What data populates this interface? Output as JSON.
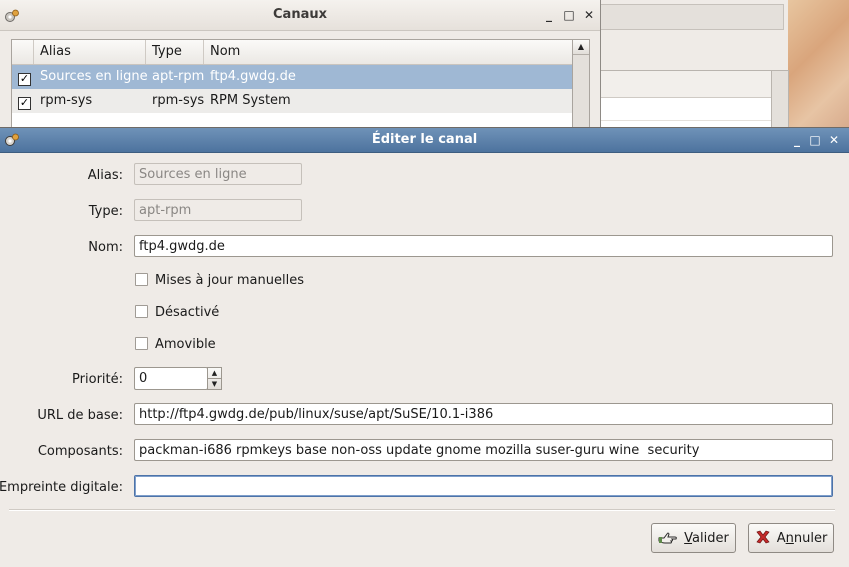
{
  "canaux": {
    "title": "Canaux",
    "columns": {
      "alias": "Alias",
      "type": "Type",
      "nom": "Nom"
    },
    "rows": [
      {
        "alias": "Sources en ligne",
        "type": "apt-rpm",
        "nom": "ftp4.gwdg.de",
        "checked": true,
        "selected": true
      },
      {
        "alias": "rpm-sys",
        "type": "rpm-sys",
        "nom": "RPM System",
        "checked": true,
        "selected": false
      }
    ]
  },
  "dialog": {
    "title": "Éditer le canal",
    "labels": {
      "alias": "Alias:",
      "type": "Type:",
      "nom": "Nom:",
      "priorite": "Priorité:",
      "url": "URL de base:",
      "composants": "Composants:",
      "empreinte": "Empreinte digitale:"
    },
    "values": {
      "alias": "Sources en ligne",
      "type": "apt-rpm",
      "nom": "ftp4.gwdg.de",
      "priorite": "0",
      "url": "http://ftp4.gwdg.de/pub/linux/suse/apt/SuSE/10.1-i386",
      "composants": "packman-i686 rpmkeys base non-oss update gnome mozilla suser-guru wine  security",
      "empreinte": ""
    },
    "checkboxes": {
      "manual": "Mises à jour manuelles",
      "disabled": "Désactivé",
      "removable": "Amovible"
    },
    "buttons": {
      "ok_mnemonic": "V",
      "ok_rest": "alider",
      "cancel_pre": "A",
      "cancel_mnemonic": "n",
      "cancel_rest": "nuler"
    }
  },
  "window_controls": {
    "minimize": "_",
    "maximize": "□",
    "close": "✕"
  },
  "icons": {
    "app": "app-gear-icon",
    "ok": "validate-hand-icon",
    "cancel": "cancel-x-icon"
  }
}
